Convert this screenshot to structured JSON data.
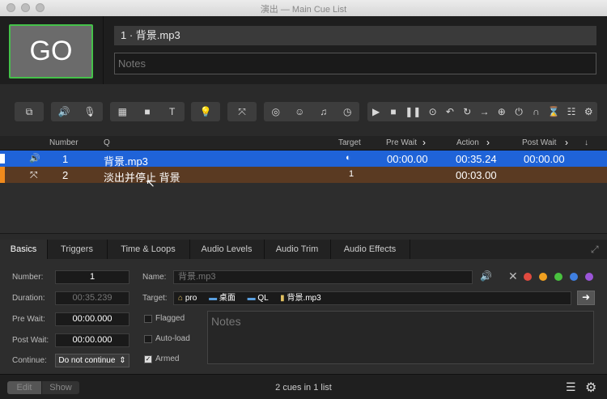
{
  "window": {
    "title": "演出 — Main Cue List"
  },
  "header": {
    "go_label": "GO",
    "cue_name": "1 · 背景.mp3",
    "notes_placeholder": "Notes"
  },
  "toolbar": {
    "groups": [
      {
        "icons": [
          "group-icon"
        ]
      },
      {
        "icons": [
          "speaker-icon",
          "mic-icon"
        ]
      },
      {
        "icons": [
          "film-icon",
          "camera-icon",
          "text-icon"
        ]
      },
      {
        "icons": [
          "lightbulb-icon"
        ]
      },
      {
        "icons": [
          "fade-icon"
        ]
      },
      {
        "icons": [
          "network-icon",
          "midi-icon",
          "music-note-icon",
          "clock-icon"
        ]
      },
      {
        "icons": [
          "play-icon",
          "stop-icon",
          "pause-icon",
          "load-icon",
          "reset-icon",
          "devamp-icon",
          "goto-icon",
          "target-icon",
          "arm-icon",
          "disarm-icon",
          "wait-icon",
          "memo-icon",
          "script-icon"
        ]
      }
    ]
  },
  "cuelist": {
    "columns": {
      "number": "Number",
      "q": "Q",
      "target": "Target",
      "pre_wait": "Pre Wait",
      "action": "Action",
      "post_wait": "Post Wait"
    },
    "rows": [
      {
        "number": "1",
        "q": "背景.mp3",
        "target_icon": "audio-target-icon",
        "pre_wait": "00:00.00",
        "action": "00:35.24",
        "post_wait": "00:00.00"
      },
      {
        "number": "2",
        "q": "淡出并停止 背景",
        "target": "1",
        "pre_wait": "",
        "action": "00:03.00",
        "post_wait": ""
      }
    ]
  },
  "inspector": {
    "tabs": [
      "Basics",
      "Triggers",
      "Time & Loops",
      "Audio Levels",
      "Audio Trim",
      "Audio Effects"
    ],
    "active_tab": "Basics",
    "number_label": "Number:",
    "number_value": "1",
    "duration_label": "Duration:",
    "duration_value": "00:35.239",
    "prewait_label": "Pre Wait:",
    "prewait_value": "00:00.000",
    "postwait_label": "Post Wait:",
    "postwait_value": "00:00.000",
    "continue_label": "Continue:",
    "continue_value": "Do not continue",
    "name_label": "Name:",
    "name_placeholder": "背景.mp3",
    "target_label": "Target:",
    "target_path": [
      "pro",
      "桌面",
      "QL",
      "背景.mp3"
    ],
    "flagged_label": "Flagged",
    "autoload_label": "Auto-load",
    "armed_label": "Armed",
    "notes_placeholder": "Notes",
    "colors": [
      "#e04a3f",
      "#f0a020",
      "#49c13f",
      "#3f7fe0",
      "#9b55d8"
    ]
  },
  "statusbar": {
    "edit_label": "Edit",
    "show_label": "Show",
    "summary": "2 cues in 1 list"
  }
}
